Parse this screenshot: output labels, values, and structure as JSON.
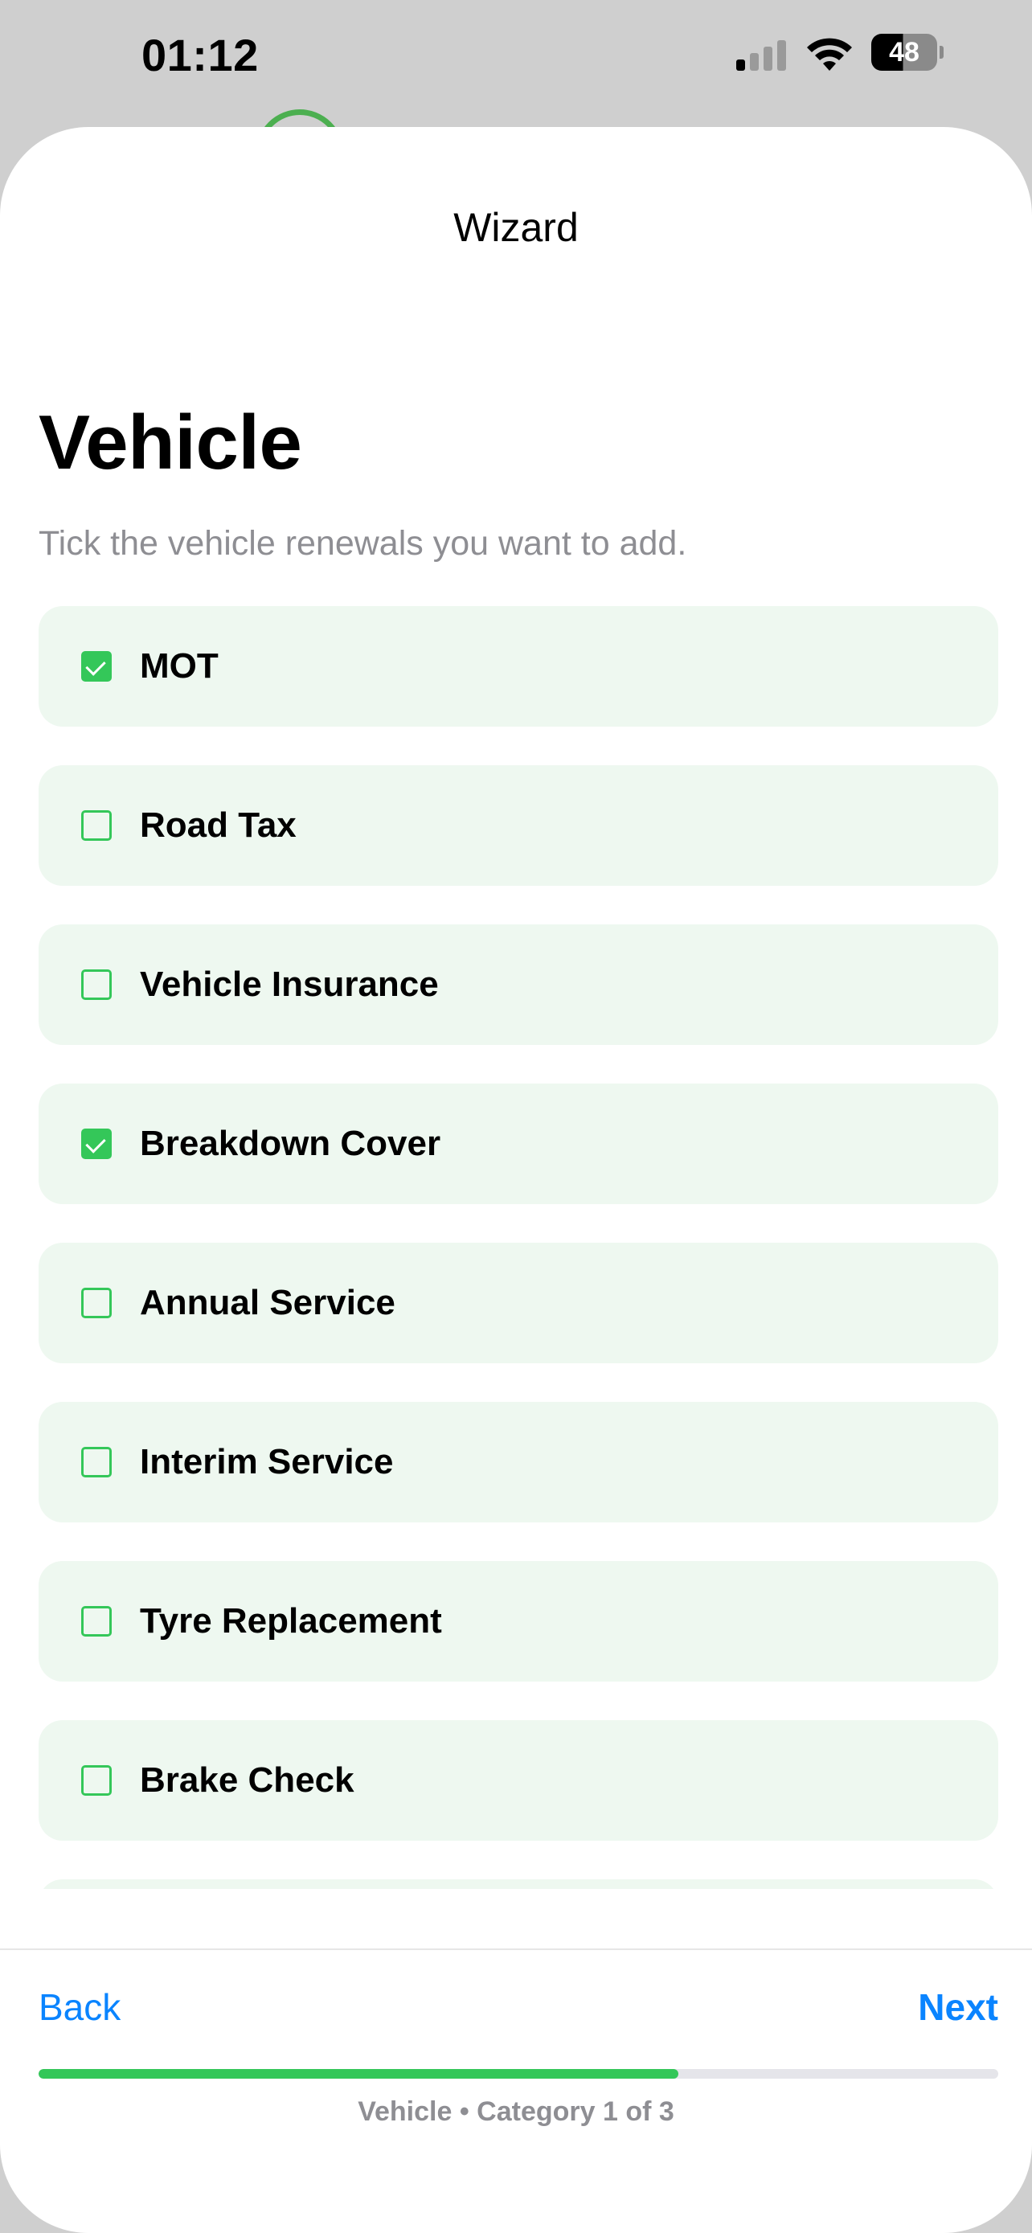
{
  "status_bar": {
    "time": "01:12",
    "battery": "48",
    "icons": [
      "signal-icon",
      "wifi-icon",
      "battery-icon"
    ]
  },
  "sheet": {
    "title": "Wizard"
  },
  "step": {
    "heading": "Vehicle",
    "subtitle": "Tick the vehicle renewals you want to add.",
    "items": [
      {
        "label": "MOT",
        "checked": true
      },
      {
        "label": "Road Tax",
        "checked": false
      },
      {
        "label": "Vehicle Insurance",
        "checked": false
      },
      {
        "label": "Breakdown Cover",
        "checked": true
      },
      {
        "label": "Annual Service",
        "checked": false
      },
      {
        "label": "Interim Service",
        "checked": false
      },
      {
        "label": "Tyre Replacement",
        "checked": false
      },
      {
        "label": "Brake Check",
        "checked": false
      }
    ]
  },
  "footer": {
    "back_label": "Back",
    "next_label": "Next",
    "progress_fraction": 0.667,
    "progress_caption": "Vehicle • Category 1 of 3"
  },
  "colors": {
    "accent_green": "#34C759",
    "row_background": "#EEF8F0",
    "link_blue": "#0A84FF"
  }
}
